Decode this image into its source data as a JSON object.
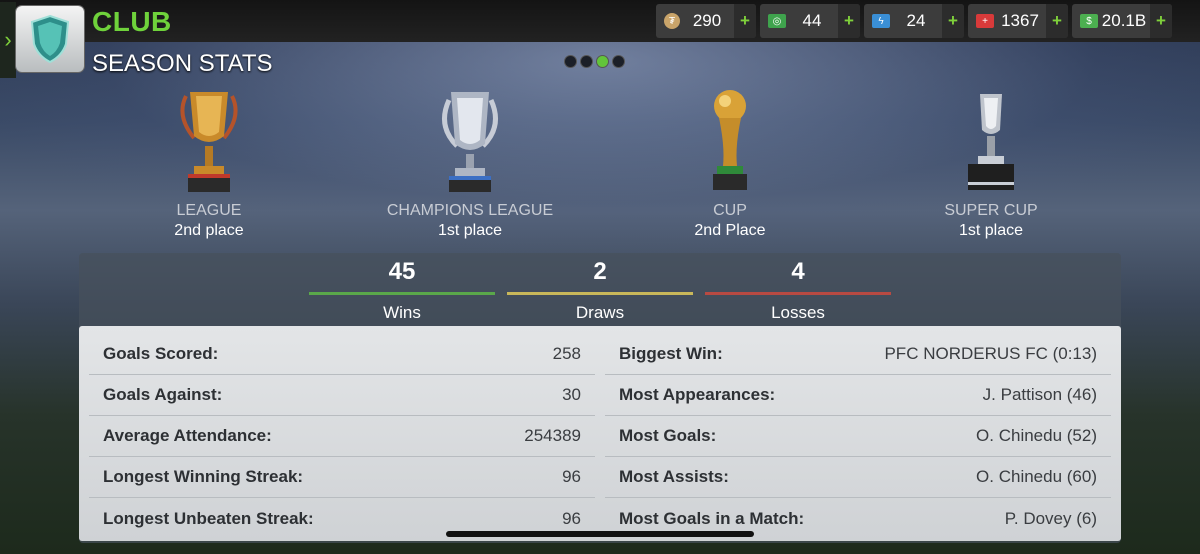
{
  "header": {
    "title": "CLUB",
    "subtitle": "SEASON STATS"
  },
  "currencies": [
    {
      "name": "coins",
      "value": "290",
      "color": "#c9a46a"
    },
    {
      "name": "cash",
      "value": "44",
      "color": "#3fa34d"
    },
    {
      "name": "energy",
      "value": "24",
      "color": "#3a8fd6"
    },
    {
      "name": "medical",
      "value": "1367",
      "color": "#d83a3a"
    },
    {
      "name": "money",
      "value": "20.1B",
      "color": "#4caf50"
    }
  ],
  "pager": {
    "count": 4,
    "active": 2
  },
  "trophies": [
    {
      "name": "LEAGUE",
      "place": "2nd place"
    },
    {
      "name": "CHAMPIONS LEAGUE",
      "place": "1st place"
    },
    {
      "name": "CUP",
      "place": "2nd Place"
    },
    {
      "name": "SUPER CUP",
      "place": "1st place"
    }
  ],
  "results": [
    {
      "value": "45",
      "label": "Wins",
      "color": "#5aa84a"
    },
    {
      "value": "2",
      "label": "Draws",
      "color": "#c9b85a"
    },
    {
      "value": "4",
      "label": "Losses",
      "color": "#b84a42"
    }
  ],
  "stats_left": [
    {
      "label": "Goals Scored:",
      "value": "258"
    },
    {
      "label": "Goals Against:",
      "value": "30"
    },
    {
      "label": "Average Attendance:",
      "value": "254389"
    },
    {
      "label": "Longest Winning Streak:",
      "value": "96"
    },
    {
      "label": "Longest Unbeaten Streak:",
      "value": "96"
    }
  ],
  "stats_right": [
    {
      "label": "Biggest Win:",
      "value": "PFC NORDERUS FC (0:13)"
    },
    {
      "label": "Most Appearances:",
      "value": "J. Pattison (46)"
    },
    {
      "label": "Most Goals:",
      "value": "O. Chinedu (52)"
    },
    {
      "label": "Most Assists:",
      "value": "O. Chinedu (60)"
    },
    {
      "label": "Most Goals in a Match:",
      "value": "P. Dovey (6)"
    }
  ]
}
